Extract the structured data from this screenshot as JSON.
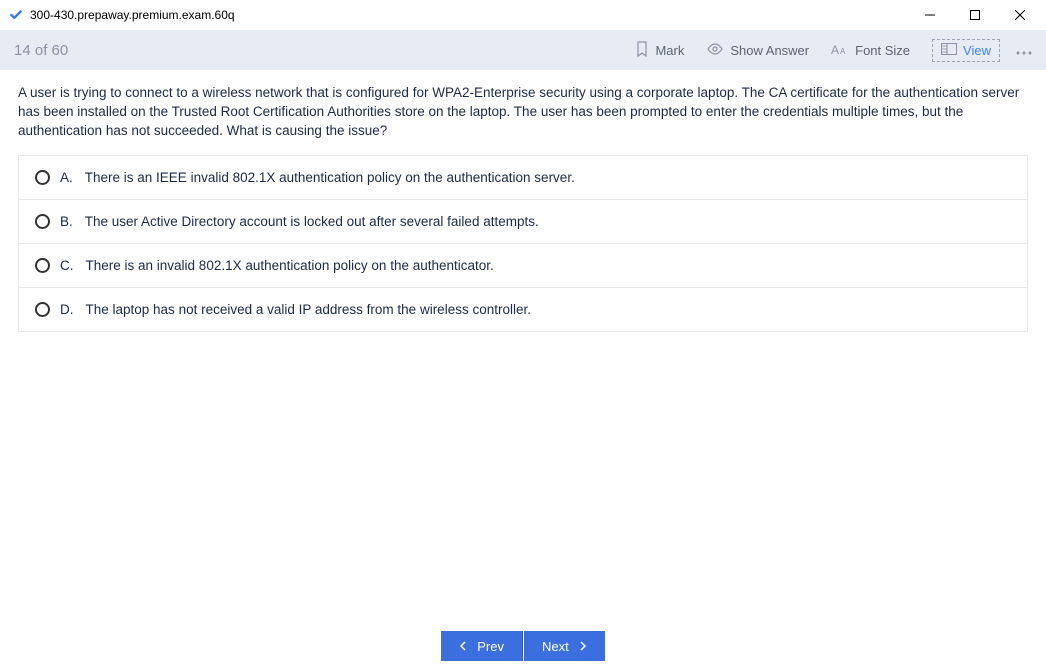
{
  "window": {
    "title": "300-430.prepaway.premium.exam.60q"
  },
  "toolbar": {
    "counter": "14 of 60",
    "mark": "Mark",
    "show_answer": "Show Answer",
    "font_size": "Font Size",
    "view": "View"
  },
  "question": {
    "text": "A user is trying to connect to a wireless network that is configured for WPA2-Enterprise security using a corporate laptop. The CA certificate for the authentication server has been installed on the Trusted Root Certification Authorities store on the laptop. The user has been prompted to enter the credentials multiple times, but the authentication has not succeeded. What is causing the issue?",
    "options": [
      {
        "letter": "A.",
        "text": "There is an IEEE invalid 802.1X authentication policy on the authentication server."
      },
      {
        "letter": "B.",
        "text": "The user Active Directory account is locked out after several failed attempts."
      },
      {
        "letter": "C.",
        "text": "There is an invalid 802.1X authentication policy on the authenticator."
      },
      {
        "letter": "D.",
        "text": "The laptop has not received a valid IP address from the wireless controller."
      }
    ]
  },
  "footer": {
    "prev": "Prev",
    "next": "Next"
  }
}
